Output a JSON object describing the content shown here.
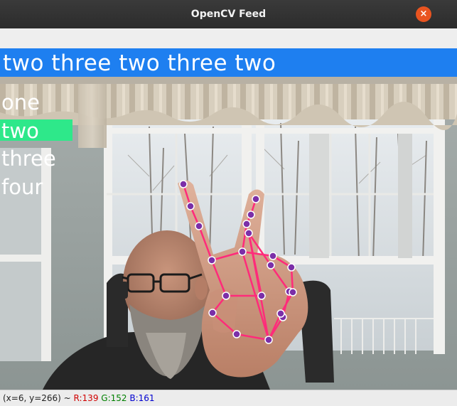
{
  "window": {
    "title": "OpenCV Feed",
    "close_glyph": "×"
  },
  "feed": {
    "banner_text": "two three two three two",
    "banner_color": "#1e7ff0",
    "highlight_color": "#2ee88a",
    "menu_items": [
      "one",
      "two",
      "three",
      "four"
    ],
    "selected_item": "two",
    "landmark_color": "#7b2fa8",
    "connection_color": "#ff2b7a"
  },
  "status": {
    "coords": "(x=6, y=266) ~ ",
    "r_label": "R:139",
    "g_label": "G:152",
    "b_label": "B:161",
    "r_color": "#d00000",
    "g_color": "#008000",
    "b_color": "#0000d0"
  }
}
